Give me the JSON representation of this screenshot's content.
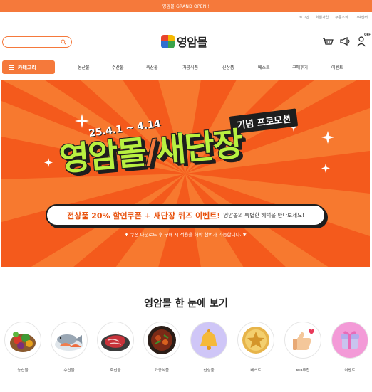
{
  "topbar": {
    "text": "영암몰 GRAND OPEN !"
  },
  "util_links": [
    "로그인",
    "회원가입",
    "주문조회",
    "고객센터"
  ],
  "search": {
    "placeholder": "",
    "icon": "search-icon"
  },
  "logo": {
    "name": "영암몰",
    "colors": [
      "#e8442d",
      "#f5b800",
      "#2f6fd1",
      "#3aa34a"
    ]
  },
  "header_icons": [
    "cart-icon",
    "megaphone-icon",
    "user-off-icon"
  ],
  "header_badge": "OFF",
  "category_button": {
    "label": "카테고리"
  },
  "nav": [
    "농산물",
    "수산물",
    "축산물",
    "가공식품",
    "신상품",
    "베스트",
    "구매후기",
    "이벤트"
  ],
  "banner": {
    "date": "25.4.1 ~ 4.14",
    "promo_tag": "기념 프로모션",
    "headline_left": "영암몰",
    "headline_right": "새단장",
    "pill_strong": "전상품 20% 할인쿠폰 + 새단장 퀴즈 이벤트!",
    "pill_light": "영암몰의 특별한 혜택을 만나보세요!",
    "note": "✱ 쿠폰 다운로드 후 구매 시 적용을 해야 참여가 가능합니다. ✱",
    "colors": {
      "bg": "#f45a1c",
      "ray": "#f7792f",
      "lime": "#b8f140",
      "dark": "#1e1e1e"
    }
  },
  "section": {
    "title": "영암몰 한 눈에 보기"
  },
  "categories": [
    {
      "label": "농산물",
      "icon": "vegetables-icon"
    },
    {
      "label": "수산물",
      "icon": "seafood-icon"
    },
    {
      "label": "축산물",
      "icon": "meat-icon"
    },
    {
      "label": "가공식품",
      "icon": "stew-icon"
    },
    {
      "label": "신상품",
      "icon": "bell-icon"
    },
    {
      "label": "베스트",
      "icon": "star-medal-icon"
    },
    {
      "label": "MD추천",
      "icon": "thumbs-up-icon"
    },
    {
      "label": "이벤트",
      "icon": "gift-icon"
    }
  ]
}
